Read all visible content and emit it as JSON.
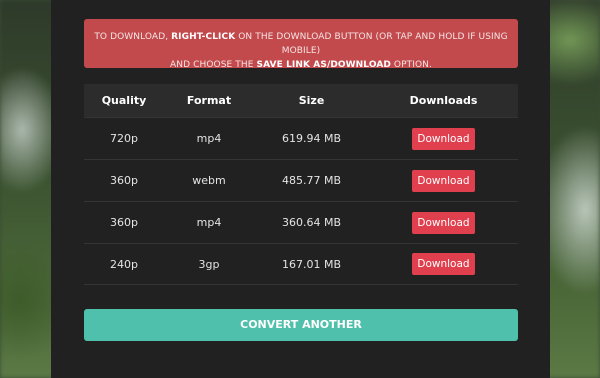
{
  "notice": {
    "part1": "TO DOWNLOAD, ",
    "bold1": "RIGHT-CLICK",
    "part2": " ON THE DOWNLOAD BUTTON (OR TAP AND HOLD IF USING MOBILE)",
    "part3": "AND CHOOSE THE ",
    "bold2": "SAVE LINK AS/DOWNLOAD",
    "part4": " OPTION."
  },
  "table": {
    "headers": {
      "quality": "Quality",
      "format": "Format",
      "size": "Size",
      "downloads": "Downloads"
    },
    "rows": [
      {
        "quality": "720p",
        "format": "mp4",
        "size": "619.94 MB",
        "button": "Download"
      },
      {
        "quality": "360p",
        "format": "webm",
        "size": "485.77 MB",
        "button": "Download"
      },
      {
        "quality": "360p",
        "format": "mp4",
        "size": "360.64 MB",
        "button": "Download"
      },
      {
        "quality": "240p",
        "format": "3gp",
        "size": "167.01 MB",
        "button": "Download"
      }
    ]
  },
  "convert_button": "CONVERT ANOTHER",
  "colors": {
    "panel": "#212121",
    "alert": "#c24a4d",
    "download_button": "#e0404e",
    "convert_button": "#4fc0ab"
  }
}
